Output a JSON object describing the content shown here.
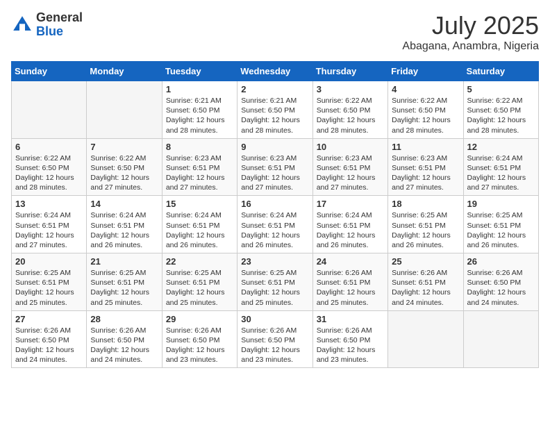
{
  "header": {
    "logo_general": "General",
    "logo_blue": "Blue",
    "month": "July 2025",
    "location": "Abagana, Anambra, Nigeria"
  },
  "days_of_week": [
    "Sunday",
    "Monday",
    "Tuesday",
    "Wednesday",
    "Thursday",
    "Friday",
    "Saturday"
  ],
  "weeks": [
    [
      {
        "day": null
      },
      {
        "day": null
      },
      {
        "day": "1",
        "sunrise": "6:21 AM",
        "sunset": "6:50 PM",
        "daylight": "12 hours and 28 minutes."
      },
      {
        "day": "2",
        "sunrise": "6:21 AM",
        "sunset": "6:50 PM",
        "daylight": "12 hours and 28 minutes."
      },
      {
        "day": "3",
        "sunrise": "6:22 AM",
        "sunset": "6:50 PM",
        "daylight": "12 hours and 28 minutes."
      },
      {
        "day": "4",
        "sunrise": "6:22 AM",
        "sunset": "6:50 PM",
        "daylight": "12 hours and 28 minutes."
      },
      {
        "day": "5",
        "sunrise": "6:22 AM",
        "sunset": "6:50 PM",
        "daylight": "12 hours and 28 minutes."
      }
    ],
    [
      {
        "day": "6",
        "sunrise": "6:22 AM",
        "sunset": "6:50 PM",
        "daylight": "12 hours and 28 minutes."
      },
      {
        "day": "7",
        "sunrise": "6:22 AM",
        "sunset": "6:50 PM",
        "daylight": "12 hours and 27 minutes."
      },
      {
        "day": "8",
        "sunrise": "6:23 AM",
        "sunset": "6:51 PM",
        "daylight": "12 hours and 27 minutes."
      },
      {
        "day": "9",
        "sunrise": "6:23 AM",
        "sunset": "6:51 PM",
        "daylight": "12 hours and 27 minutes."
      },
      {
        "day": "10",
        "sunrise": "6:23 AM",
        "sunset": "6:51 PM",
        "daylight": "12 hours and 27 minutes."
      },
      {
        "day": "11",
        "sunrise": "6:23 AM",
        "sunset": "6:51 PM",
        "daylight": "12 hours and 27 minutes."
      },
      {
        "day": "12",
        "sunrise": "6:24 AM",
        "sunset": "6:51 PM",
        "daylight": "12 hours and 27 minutes."
      }
    ],
    [
      {
        "day": "13",
        "sunrise": "6:24 AM",
        "sunset": "6:51 PM",
        "daylight": "12 hours and 27 minutes."
      },
      {
        "day": "14",
        "sunrise": "6:24 AM",
        "sunset": "6:51 PM",
        "daylight": "12 hours and 26 minutes."
      },
      {
        "day": "15",
        "sunrise": "6:24 AM",
        "sunset": "6:51 PM",
        "daylight": "12 hours and 26 minutes."
      },
      {
        "day": "16",
        "sunrise": "6:24 AM",
        "sunset": "6:51 PM",
        "daylight": "12 hours and 26 minutes."
      },
      {
        "day": "17",
        "sunrise": "6:24 AM",
        "sunset": "6:51 PM",
        "daylight": "12 hours and 26 minutes."
      },
      {
        "day": "18",
        "sunrise": "6:25 AM",
        "sunset": "6:51 PM",
        "daylight": "12 hours and 26 minutes."
      },
      {
        "day": "19",
        "sunrise": "6:25 AM",
        "sunset": "6:51 PM",
        "daylight": "12 hours and 26 minutes."
      }
    ],
    [
      {
        "day": "20",
        "sunrise": "6:25 AM",
        "sunset": "6:51 PM",
        "daylight": "12 hours and 25 minutes."
      },
      {
        "day": "21",
        "sunrise": "6:25 AM",
        "sunset": "6:51 PM",
        "daylight": "12 hours and 25 minutes."
      },
      {
        "day": "22",
        "sunrise": "6:25 AM",
        "sunset": "6:51 PM",
        "daylight": "12 hours and 25 minutes."
      },
      {
        "day": "23",
        "sunrise": "6:25 AM",
        "sunset": "6:51 PM",
        "daylight": "12 hours and 25 minutes."
      },
      {
        "day": "24",
        "sunrise": "6:26 AM",
        "sunset": "6:51 PM",
        "daylight": "12 hours and 25 minutes."
      },
      {
        "day": "25",
        "sunrise": "6:26 AM",
        "sunset": "6:51 PM",
        "daylight": "12 hours and 24 minutes."
      },
      {
        "day": "26",
        "sunrise": "6:26 AM",
        "sunset": "6:50 PM",
        "daylight": "12 hours and 24 minutes."
      }
    ],
    [
      {
        "day": "27",
        "sunrise": "6:26 AM",
        "sunset": "6:50 PM",
        "daylight": "12 hours and 24 minutes."
      },
      {
        "day": "28",
        "sunrise": "6:26 AM",
        "sunset": "6:50 PM",
        "daylight": "12 hours and 24 minutes."
      },
      {
        "day": "29",
        "sunrise": "6:26 AM",
        "sunset": "6:50 PM",
        "daylight": "12 hours and 23 minutes."
      },
      {
        "day": "30",
        "sunrise": "6:26 AM",
        "sunset": "6:50 PM",
        "daylight": "12 hours and 23 minutes."
      },
      {
        "day": "31",
        "sunrise": "6:26 AM",
        "sunset": "6:50 PM",
        "daylight": "12 hours and 23 minutes."
      },
      {
        "day": null
      },
      {
        "day": null
      }
    ]
  ]
}
